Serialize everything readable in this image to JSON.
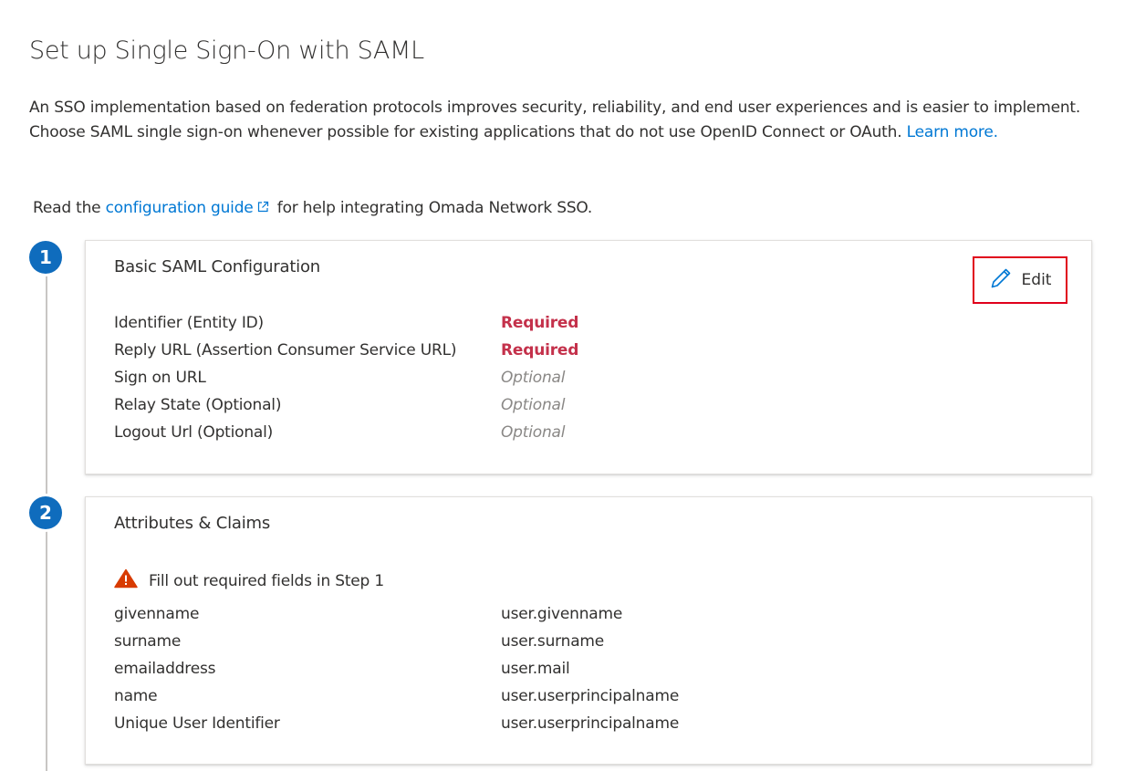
{
  "page_title": "Set up Single Sign-On with SAML",
  "intro": {
    "text": "An SSO implementation based on federation protocols improves security, reliability, and end user experiences and is easier to implement. Choose SAML single sign-on whenever possible for existing applications that do not use OpenID Connect or OAuth.",
    "learn_more": "Learn more."
  },
  "guide": {
    "prefix": "Read the",
    "link": "configuration guide",
    "suffix": "for help integrating Omada Network SSO."
  },
  "steps": [
    {
      "number": "1",
      "title": "Basic SAML Configuration",
      "edit_label": "Edit",
      "fields": [
        {
          "label": "Identifier (Entity ID)",
          "value": "Required"
        },
        {
          "label": "Reply URL (Assertion Consumer Service URL)",
          "value": "Required"
        },
        {
          "label": "Sign on URL",
          "value": "Optional"
        },
        {
          "label": "Relay State (Optional)",
          "value": "Optional"
        },
        {
          "label": "Logout Url (Optional)",
          "value": "Optional"
        }
      ]
    },
    {
      "number": "2",
      "title": "Attributes & Claims",
      "warning": "Fill out required fields in Step 1",
      "claims": [
        {
          "name": "givenname",
          "value": "user.givenname"
        },
        {
          "name": "surname",
          "value": "user.surname"
        },
        {
          "name": "emailaddress",
          "value": "user.mail"
        },
        {
          "name": "name",
          "value": "user.userprincipalname"
        },
        {
          "name": "Unique User Identifier",
          "value": "user.userprincipalname"
        }
      ]
    }
  ],
  "colors": {
    "link": "#0078d4",
    "step_badge": "#0f6cbd",
    "required": "#c4314b",
    "optional": "#8a8886",
    "warning": "#d83b01",
    "edit_highlight": "#e0001b"
  },
  "icons": {
    "edit": "pencil-icon",
    "external_link": "external-link-icon",
    "warning": "warning-icon"
  }
}
